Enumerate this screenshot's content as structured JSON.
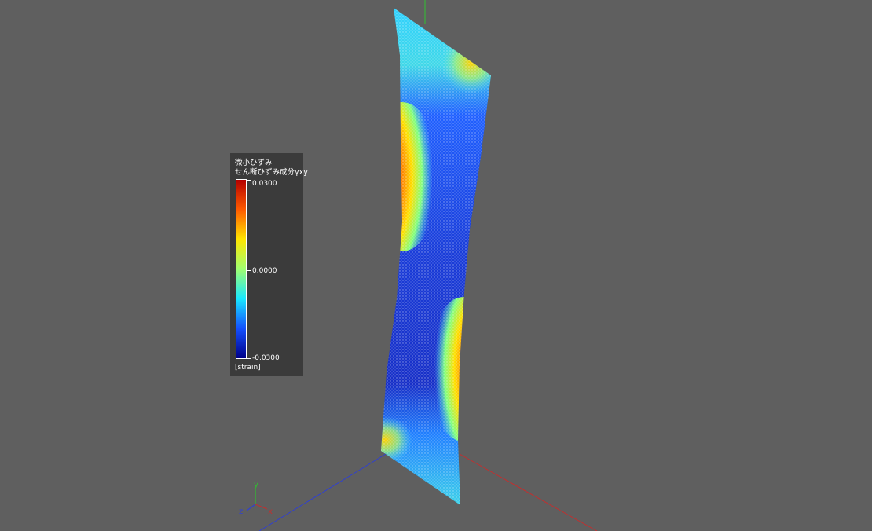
{
  "legend": {
    "title_line1": "微小ひずみ",
    "title_line2": "せん断ひずみ成分γxy",
    "max_label": "0.0300",
    "mid_label": "0.0000",
    "min_label": "-0.0300",
    "unit": "[strain]",
    "colormap": [
      "#b40000",
      "#ff5a00",
      "#ffe600",
      "#a0ff70",
      "#18e8ff",
      "#1450ff",
      "#000088"
    ]
  },
  "axis_triad": {
    "x_label": "x",
    "y_label": "y",
    "z_label": "z"
  },
  "colors": {
    "background": "#5f5f5f",
    "legend_background": "#3b3b3b",
    "x_axis": "#c03030",
    "y_axis": "#30c030",
    "z_axis": "#3040d0"
  }
}
